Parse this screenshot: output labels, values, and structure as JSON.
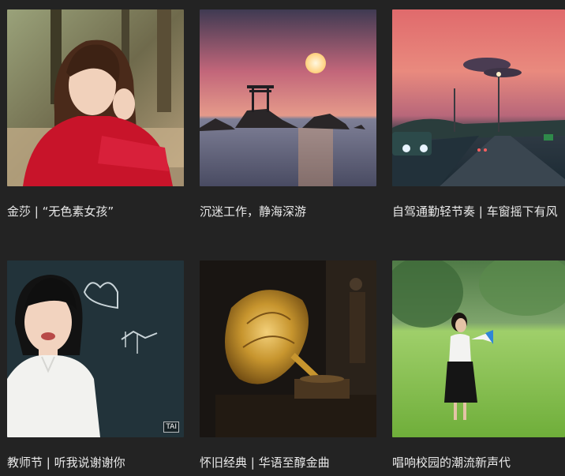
{
  "playlists": [
    {
      "title": "金莎 | “无色素女孩”",
      "cover": "portrait-red-sweater"
    },
    {
      "title": "沉迷工作，静海深游",
      "cover": "sunset-sea-torii"
    },
    {
      "title": "自驾通勤轻节奏 | 车窗摇下有风",
      "cover": "evening-highway"
    },
    {
      "title": "教师节 | 听我说谢谢你",
      "cover": "girl-at-chalkboard"
    },
    {
      "title": "怀旧经典 | 华语至醇金曲",
      "cover": "golden-gramophone"
    },
    {
      "title": "唱响校园的潮流新声代",
      "cover": "girl-with-megaphone"
    }
  ],
  "cover_watermark": "TAI"
}
